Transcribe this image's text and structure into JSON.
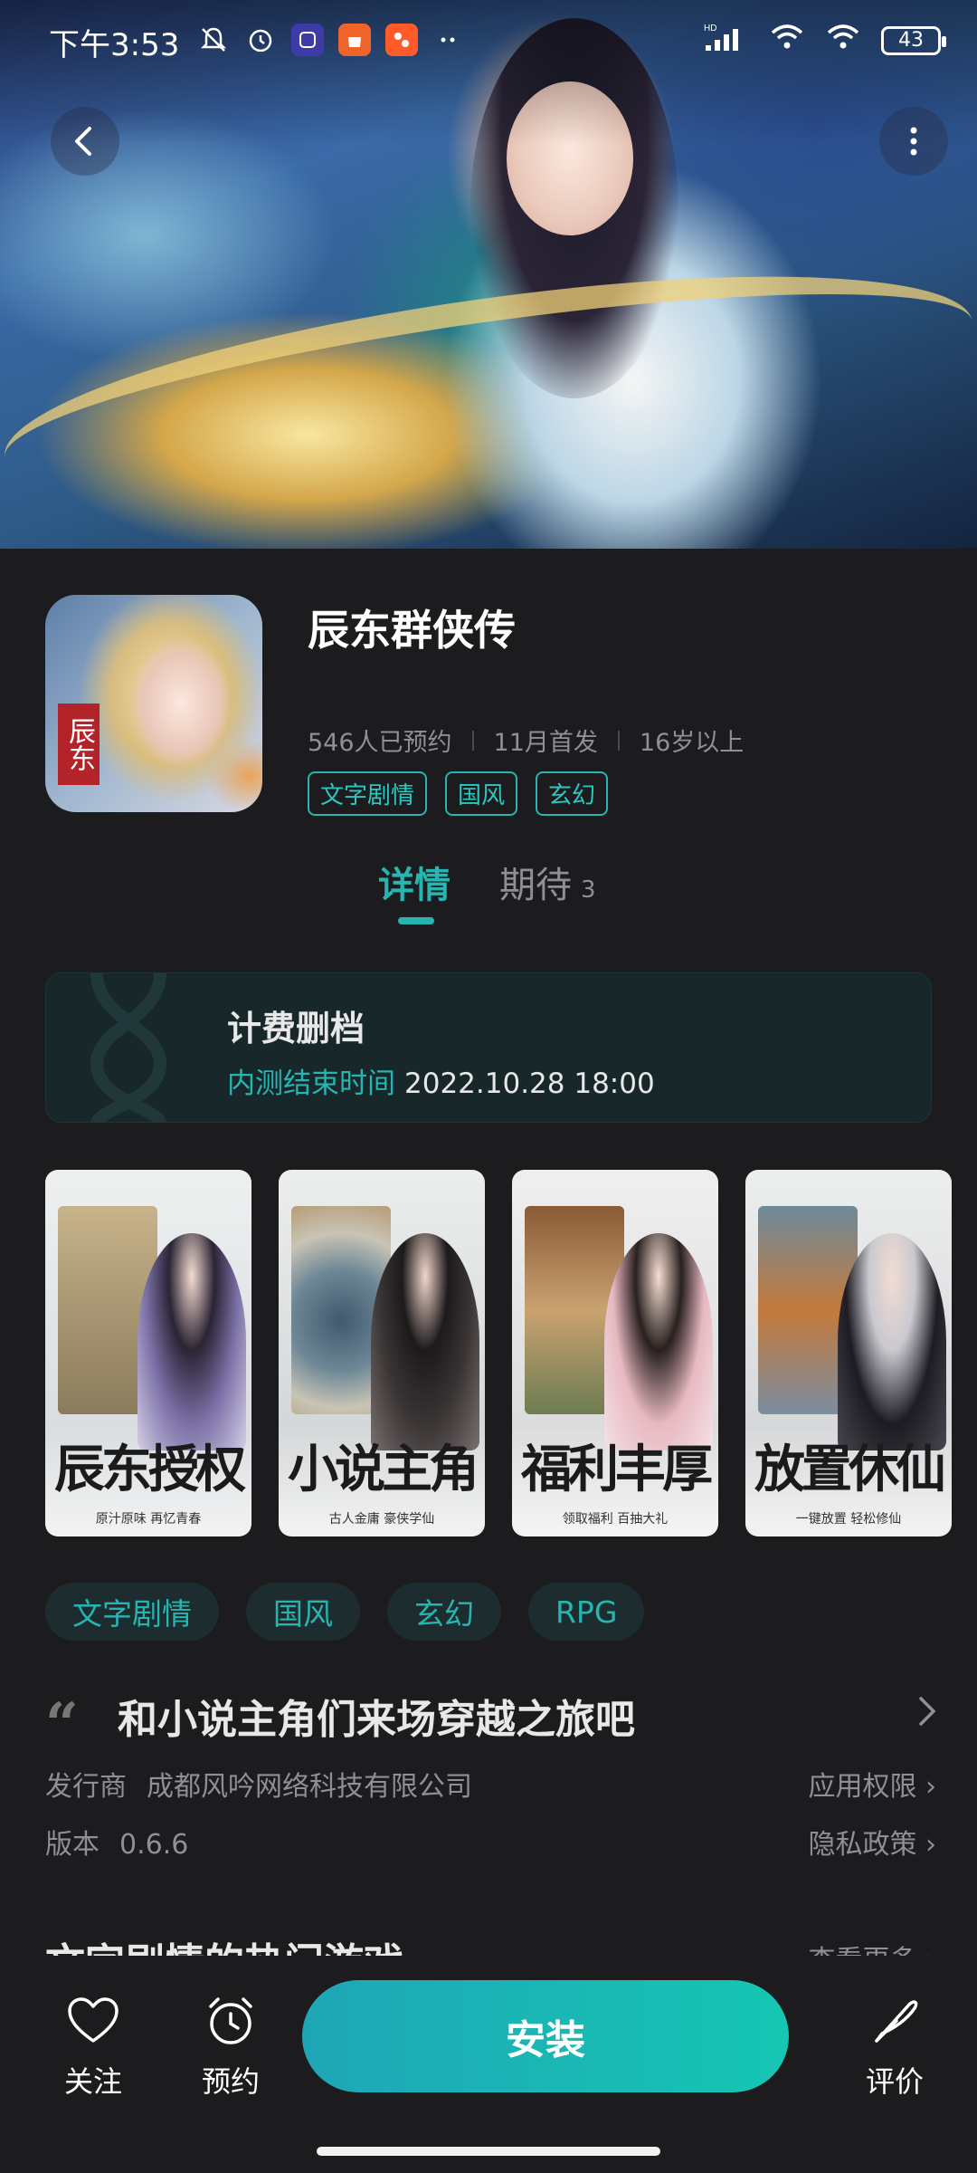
{
  "status_bar": {
    "time": "下午3:53",
    "network": "HD",
    "battery": "43"
  },
  "hero": {
    "back_icon": "back-arrow-icon",
    "more_icon": "more-vertical-icon"
  },
  "app": {
    "title": "辰东群侠传",
    "icon_seal_text": "辰东",
    "reservations": "546人已预约",
    "release": "11月首发",
    "age": "16岁以上",
    "tags": [
      "文字剧情",
      "国风",
      "玄幻"
    ]
  },
  "tabs": {
    "detail": "详情",
    "expect": "期待",
    "expect_count": "3"
  },
  "notice": {
    "title": "计费删档",
    "label": "内测结束时间",
    "date": "2022.10.28 18:00"
  },
  "screenshots": [
    {
      "caption": "辰东授权",
      "subtitle": "原汁原味 再忆青春"
    },
    {
      "caption": "小说主角",
      "subtitle": "古人金庸 豪侠学仙"
    },
    {
      "caption": "福利丰厚",
      "subtitle": "领取福利 百抽大礼"
    },
    {
      "caption": "放置休仙",
      "subtitle": "一键放置 轻松修仙"
    }
  ],
  "genre_chips": [
    "文字剧情",
    "国风",
    "玄幻",
    "RPG"
  ],
  "slogan": "和小说主角们来场穿越之旅吧",
  "publisher": {
    "label": "发行商",
    "value": "成都风吟网络科技有限公司",
    "permissions_link": "应用权限 ›"
  },
  "version": {
    "label": "版本",
    "value": "0.6.6",
    "privacy_link": "隐私政策 ›"
  },
  "related": {
    "title": "文字剧情的热门游戏",
    "more": "查看更多 ›"
  },
  "bottom_bar": {
    "follow": "关注",
    "reserve": "预约",
    "install": "安装",
    "review": "评价"
  },
  "colors": {
    "accent": "#26b5b0",
    "background": "#1c1c1e",
    "install_gradient_start": "#1fa6b6",
    "install_gradient_end": "#16c6b3"
  }
}
